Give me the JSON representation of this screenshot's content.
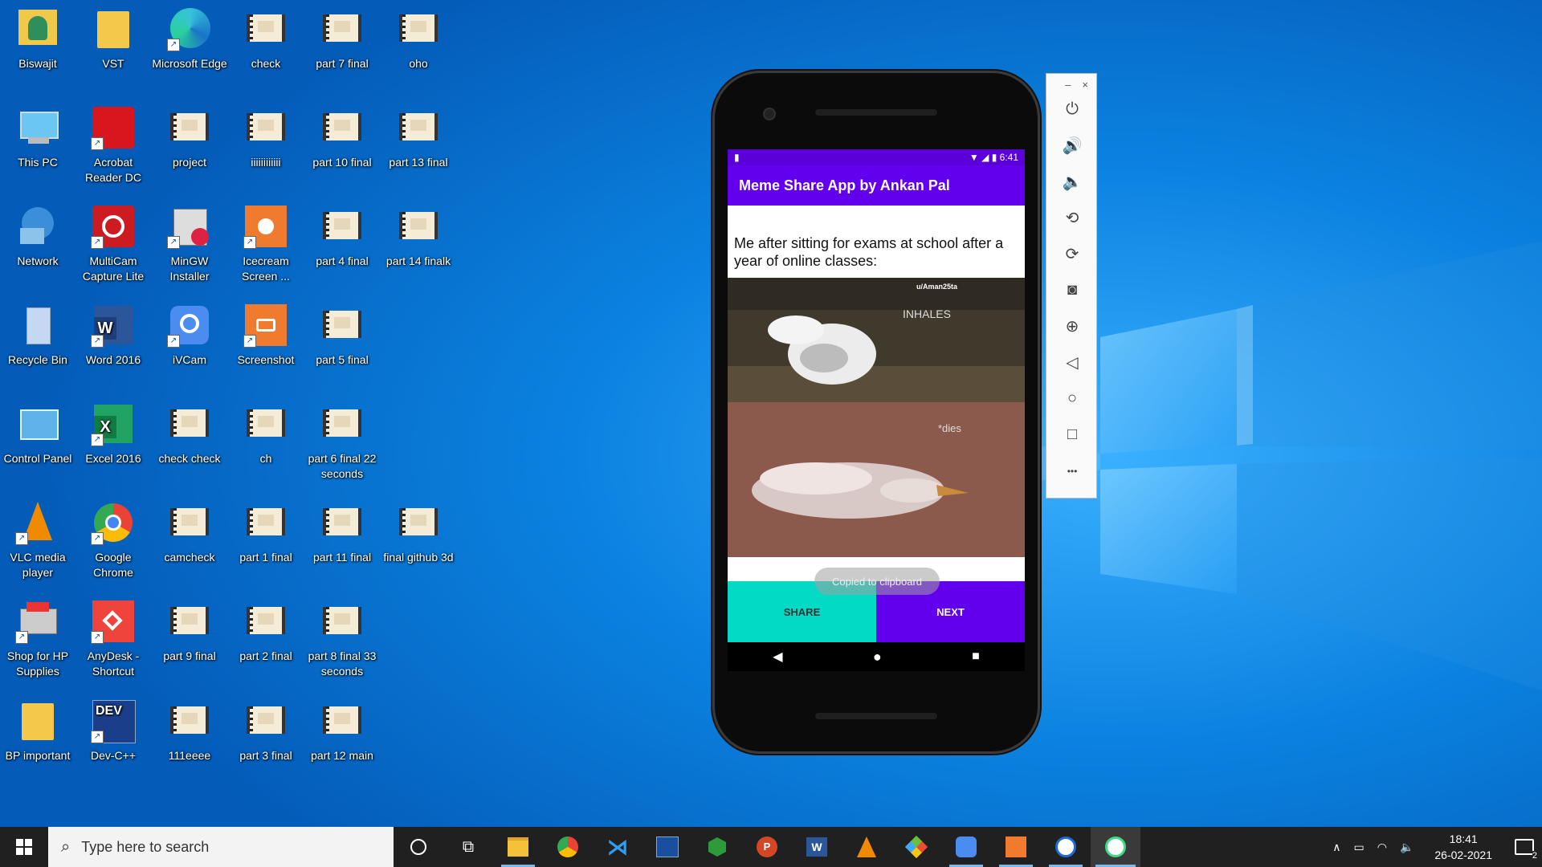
{
  "desktop": {
    "icons": [
      {
        "label": "Biswajit",
        "icon": "user-folder-icon"
      },
      {
        "label": "VST",
        "icon": "folder-icon"
      },
      {
        "label": "Microsoft Edge",
        "icon": "edge-icon"
      },
      {
        "label": "check",
        "icon": "video-file-icon"
      },
      {
        "label": "part 7 final",
        "icon": "video-file-icon"
      },
      {
        "label": "oho",
        "icon": "video-file-icon"
      },
      {
        "label": "This PC",
        "icon": "computer-icon"
      },
      {
        "label": "Acrobat Reader DC",
        "icon": "acrobat-icon"
      },
      {
        "label": "project",
        "icon": "video-file-icon"
      },
      {
        "label": "iiiiiiiiiiii",
        "icon": "video-file-icon"
      },
      {
        "label": "part 10 final",
        "icon": "video-file-icon"
      },
      {
        "label": "part 13 final",
        "icon": "video-file-icon"
      },
      {
        "label": "Network",
        "icon": "network-icon"
      },
      {
        "label": "MultiCam Capture Lite",
        "icon": "multicam-icon"
      },
      {
        "label": "MinGW Installer",
        "icon": "installer-icon"
      },
      {
        "label": "Icecream Screen ...",
        "icon": "icecream-icon"
      },
      {
        "label": "part 4 final",
        "icon": "video-file-icon"
      },
      {
        "label": "part 14 finalk",
        "icon": "video-file-icon"
      },
      {
        "label": "Recycle Bin",
        "icon": "recycle-bin-icon"
      },
      {
        "label": "Word 2016",
        "icon": "word-icon"
      },
      {
        "label": "iVCam",
        "icon": "ivcam-icon"
      },
      {
        "label": "Screenshot",
        "icon": "screenshot-icon"
      },
      {
        "label": "part 5 final",
        "icon": "video-file-icon"
      },
      {
        "label": "Control Panel",
        "icon": "control-panel-icon"
      },
      {
        "label": "Excel 2016",
        "icon": "excel-icon"
      },
      {
        "label": "check check",
        "icon": "video-file-icon"
      },
      {
        "label": "ch",
        "icon": "video-file-icon"
      },
      {
        "label": "part 6 final 22 seconds",
        "icon": "video-file-icon"
      },
      {
        "label": "VLC media player",
        "icon": "vlc-icon"
      },
      {
        "label": "Google Chrome",
        "icon": "chrome-icon"
      },
      {
        "label": "camcheck",
        "icon": "video-file-icon"
      },
      {
        "label": "part 1 final",
        "icon": "video-file-icon"
      },
      {
        "label": "part 11 final",
        "icon": "video-file-icon"
      },
      {
        "label": "final github 3d",
        "icon": "video-file-icon"
      },
      {
        "label": "Shop for HP Supplies",
        "icon": "printer-icon"
      },
      {
        "label": "AnyDesk - Shortcut",
        "icon": "anydesk-icon"
      },
      {
        "label": "part 9 final",
        "icon": "video-file-icon"
      },
      {
        "label": "part 2 final",
        "icon": "video-file-icon"
      },
      {
        "label": "part 8 final 33 seconds",
        "icon": "video-file-icon"
      },
      {
        "label": "BP important",
        "icon": "folder-icon"
      },
      {
        "label": "Dev-C++",
        "icon": "devcpp-icon"
      },
      {
        "label": "111eeee",
        "icon": "video-file-icon"
      },
      {
        "label": "part 3 final",
        "icon": "video-file-icon"
      },
      {
        "label": "part 12 main",
        "icon": "video-file-icon"
      }
    ]
  },
  "phone": {
    "status_time": "6:41",
    "app_title": "Meme Share App by Ankan Pal",
    "meme_caption": "Me after sitting for exams at school after a year of online classes:",
    "meme_watermark": "u/Aman25ta",
    "meme_top_text": "INHALES",
    "meme_bottom_text": "*dies",
    "share_label": "SHARE",
    "next_label": "NEXT",
    "toast": "Copied to clipboard"
  },
  "emulator_toolbar": {
    "minimize": "–",
    "close": "×",
    "more": "•••"
  },
  "taskbar": {
    "search_placeholder": "Type here to search",
    "time": "18:41",
    "date": "26-02-2021",
    "notification_count": "2"
  },
  "colors": {
    "app_bar": "#6200ee",
    "share_button": "#03dac5",
    "desktop_bg": "#0a78d8"
  }
}
